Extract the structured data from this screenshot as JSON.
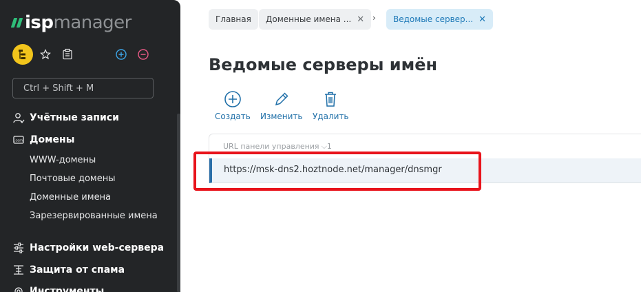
{
  "brand": {
    "name_bold": "isp",
    "name_light": "manager"
  },
  "sidebar": {
    "search": {
      "placeholder": "Ctrl + Shift + M"
    },
    "sections": [
      {
        "label": "Учётные записи",
        "icon": "users-icon"
      },
      {
        "label": "Домены",
        "icon": "domains-icon",
        "children": [
          "WWW-домены",
          "Почтовые домены",
          "Доменные имена",
          "Зарезервированные имена"
        ]
      },
      {
        "label": "Настройки web-сервера",
        "icon": "sliders-icon"
      },
      {
        "label": "Защита от спама",
        "icon": "filter-icon"
      },
      {
        "label": "Инструменты",
        "icon": "wrench-icon"
      }
    ]
  },
  "breadcrumbs": [
    {
      "label": "Главная"
    },
    {
      "label": "Доменные имена ..."
    },
    {
      "label": "Ведомые сервер..."
    }
  ],
  "breadcrumb_separator": "›",
  "page": {
    "title": "Ведомые серверы имён"
  },
  "toolbar": {
    "create": "Создать",
    "edit": "Изменить",
    "delete": "Удалить"
  },
  "table": {
    "column": "URL панели управления",
    "sort_indicator": "1",
    "rows": [
      {
        "url": "https://msk-dns2.hoztnode.net/manager/dnsmgr"
      }
    ]
  },
  "colors": {
    "sidebar_bg": "#232527",
    "accent": "#1f6fa8",
    "highlight": "#e8131b",
    "logo_green": "#2fbf7a",
    "avatar": "#f2c51c"
  }
}
